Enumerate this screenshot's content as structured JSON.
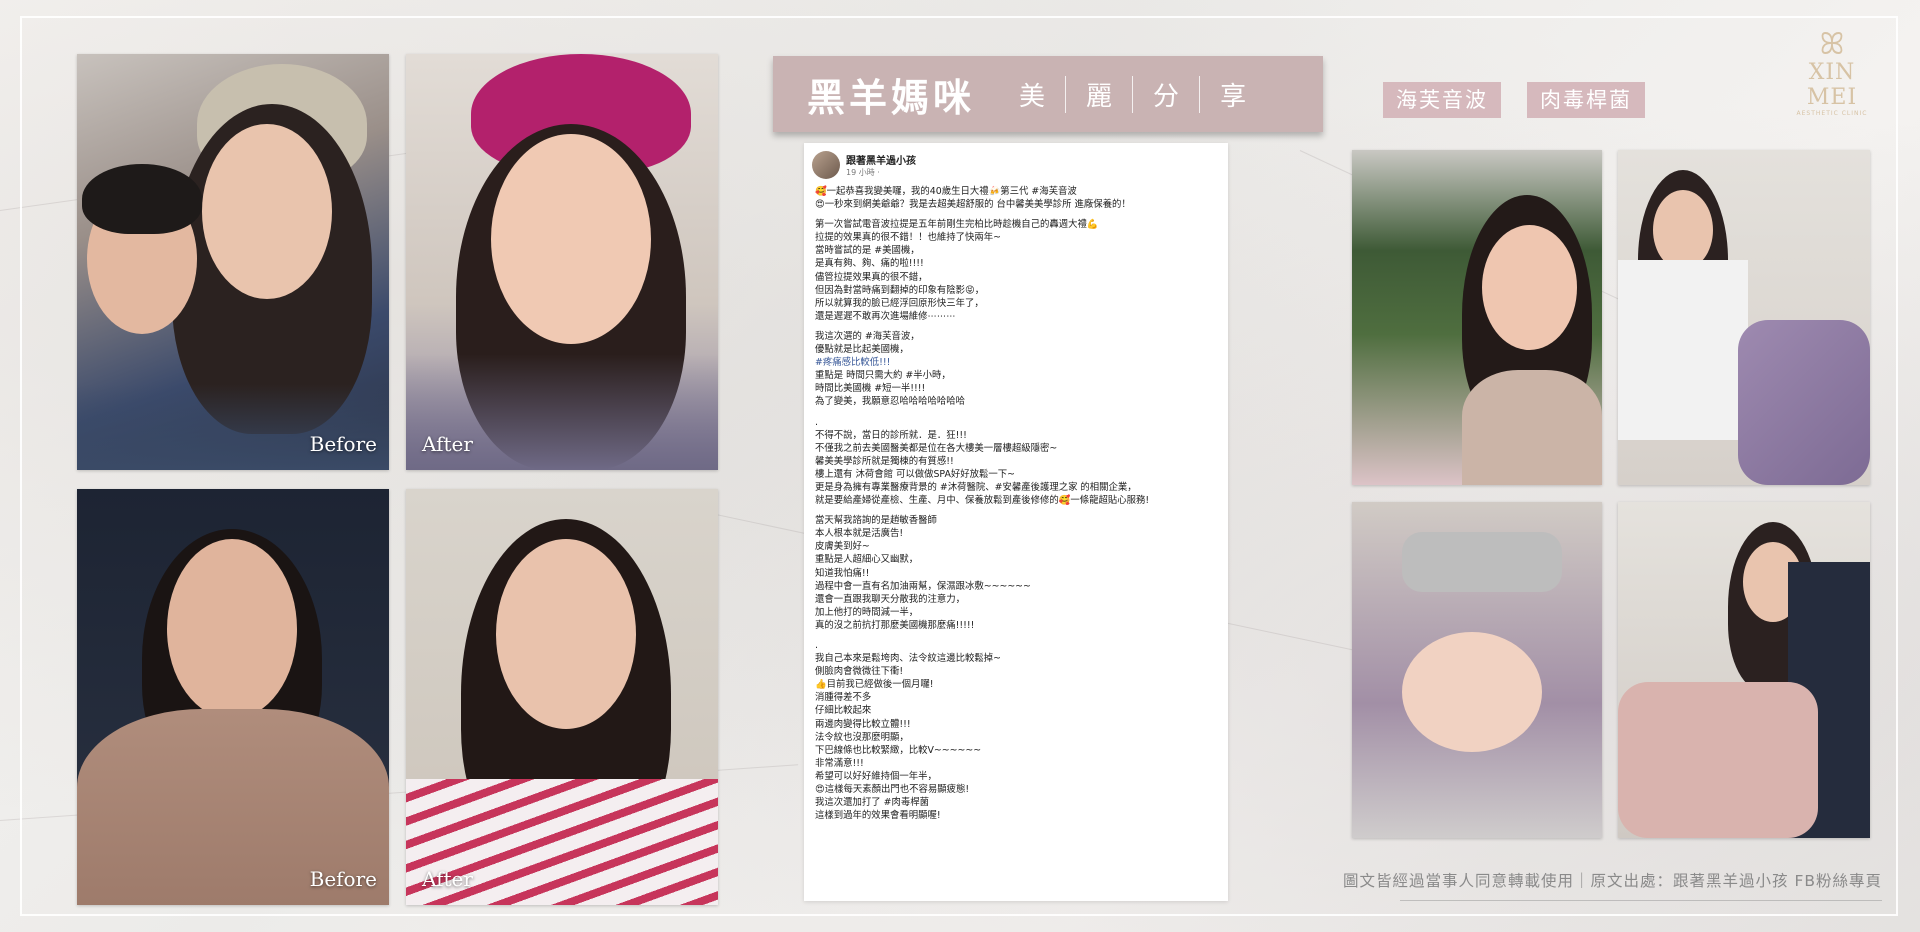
{
  "title": {
    "main": "黑羊媽咪",
    "sub": [
      "美",
      "麗",
      "分",
      "享"
    ]
  },
  "chips": [
    "海芙音波",
    "肉毒桿菌"
  ],
  "logo": {
    "name": "XIN MEI",
    "small": "AESTHETIC CLINIC"
  },
  "photo_labels": {
    "before": "Before",
    "after": "After"
  },
  "post": {
    "author": "跟著黑羊過小孩",
    "time": "19 小時 ·",
    "paragraphs": [
      [
        {
          "text": "🥰一起恭喜我變美囉，我的40歲生日大禮🍻第三代 #海芙音波",
          "link": false
        },
        {
          "text": "😍一秒來到網美爺爺？我是去超美超舒服的 台中馨美美學診所 進廠保養的！",
          "link": false
        }
      ],
      [
        {
          "text": "第一次嘗試電音波拉提是五年前剛生完柏比時趁機自己的轟週大禮💪",
          "link": false
        },
        {
          "text": "拉提的效果真的很不錯！！也維持了快兩年~",
          "link": false
        },
        {
          "text": "當時嘗試的是 #美國機，",
          "link": false
        },
        {
          "text": "是真有夠、夠、痛的啦!!!!",
          "link": false
        },
        {
          "text": "儘管拉提效果真的很不錯，",
          "link": false
        },
        {
          "text": "但因為對當時痛到翻掉的印象有陰影😝，",
          "link": false
        },
        {
          "text": "所以就算我的臉已經浮回原形快三年了，",
          "link": false
        },
        {
          "text": "還是遲遲不敢再次進場維修⋯⋯⋯",
          "link": false
        }
      ],
      [
        {
          "text": "我這次選的 #海芙音波，",
          "link": false
        },
        {
          "text": "優點就是比起美國機，",
          "link": false
        },
        {
          "text": "#疼痛感比較低!!!",
          "link": true
        },
        {
          "text": "重點是 時間只需大約 #半小時，",
          "link": false
        },
        {
          "text": "時間比美國機 #短一半!!!!",
          "link": false
        },
        {
          "text": "為了變美，我願意忍哈哈哈哈哈哈哈",
          "link": false
        }
      ],
      [
        {
          "text": ".",
          "link": false
        },
        {
          "text": "不得不說，當日的診所就．是．狂!!!",
          "link": false
        },
        {
          "text": "不僅我之前去美國醫美都是位在各大樓美一層樓超級隱密~",
          "link": false
        },
        {
          "text": "馨美美學診所就是獨棟的有質感!!",
          "link": false
        },
        {
          "text": "樓上還有 沐荷會館 可以做做SPA好好放鬆一下~",
          "link": false
        },
        {
          "text": "更是身為擁有專業醫療背景的 #沐荷醫院、#安馨產後護理之家 的相關企業，",
          "link": false
        },
        {
          "text": "就是要給產婦從產檢、生產、月中、保養放鬆到產後修修的🥰一條龍超貼心服務!",
          "link": false
        }
      ],
      [
        {
          "text": "當天幫我諮詢的是趙敏香醫師",
          "link": false
        },
        {
          "text": "本人根本就是活廣告!",
          "link": false
        },
        {
          "text": "皮膚美到好~",
          "link": false
        },
        {
          "text": "重點是人超細心又幽默，",
          "link": false
        },
        {
          "text": "知道我怕痛!!",
          "link": false
        },
        {
          "text": "過程中會一直有名加油兩幫，保濕跟冰敷~~~~~~",
          "link": false
        },
        {
          "text": "還會一直跟我聊天分散我的注意力，",
          "link": false
        },
        {
          "text": "加上他打的時間減一半，",
          "link": false
        },
        {
          "text": "真的沒之前抗打那麼美國機那麼痛!!!!!",
          "link": false
        }
      ],
      [
        {
          "text": ".",
          "link": false
        },
        {
          "text": "我自己本來是鬆垮肉、法令紋這邊比較鬆掉~",
          "link": false
        },
        {
          "text": "側臉肉會微微往下衝!",
          "link": false
        },
        {
          "text": "👍目前我已經做後一個月囉!",
          "link": false
        },
        {
          "text": "消腫得差不多",
          "link": false
        },
        {
          "text": "仔細比較起來",
          "link": false
        },
        {
          "text": "兩邊肉變得比較立體!!!",
          "link": false
        },
        {
          "text": "法令紋也沒那麼明顯，",
          "link": false
        },
        {
          "text": "下巴線條也比較緊緻，比較V~~~~~~",
          "link": false
        },
        {
          "text": "非常滿意!!!",
          "link": false
        },
        {
          "text": "希望可以好好維持個一年半，",
          "link": false
        },
        {
          "text": "😍這樣每天素顏出門也不容易顯疲態!",
          "link": false
        },
        {
          "text": "我這次還加打了 #肉毒桿菌",
          "link": false
        },
        {
          "text": "這樣到過年的效果會看明顯喔!",
          "link": false
        }
      ]
    ]
  },
  "footer": "圖文皆經過當事人同意轉載使用｜原文出處：跟著黑羊過小孩 FB粉絲專頁"
}
